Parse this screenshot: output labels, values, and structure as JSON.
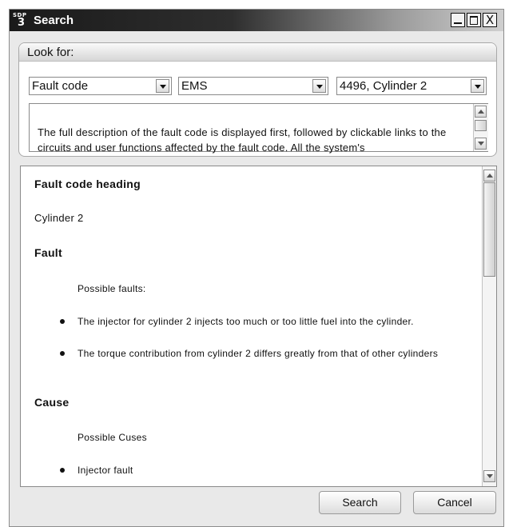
{
  "window": {
    "title": "Search",
    "logo_sdp": "SDP",
    "logo_num": "3",
    "close_glyph": "X"
  },
  "look_for": {
    "label": "Look for:",
    "combos": [
      {
        "value": "Fault code"
      },
      {
        "value": "EMS"
      },
      {
        "value": "4496, Cylinder 2"
      }
    ],
    "description": "The full description of the fault code is displayed first, followed by clickable links to the circuits and user functions affected by the fault code. All the system's"
  },
  "content": {
    "fault_code_heading": "Fault code heading",
    "fault_code_value": "Cylinder 2",
    "fault_heading": "Fault",
    "possible_faults_label": "Possible faults:",
    "faults": [
      "The injector for cylinder 2 injects too much or too little fuel into the cylinder.",
      "The torque contribution from cylinder 2 differs greatly from that of other cylinders"
    ],
    "cause_heading": "Cause",
    "possible_causes_label": "Possible Cuses",
    "causes": [
      "Injector fault"
    ]
  },
  "buttons": {
    "search": "Search",
    "cancel": "Cancel"
  }
}
